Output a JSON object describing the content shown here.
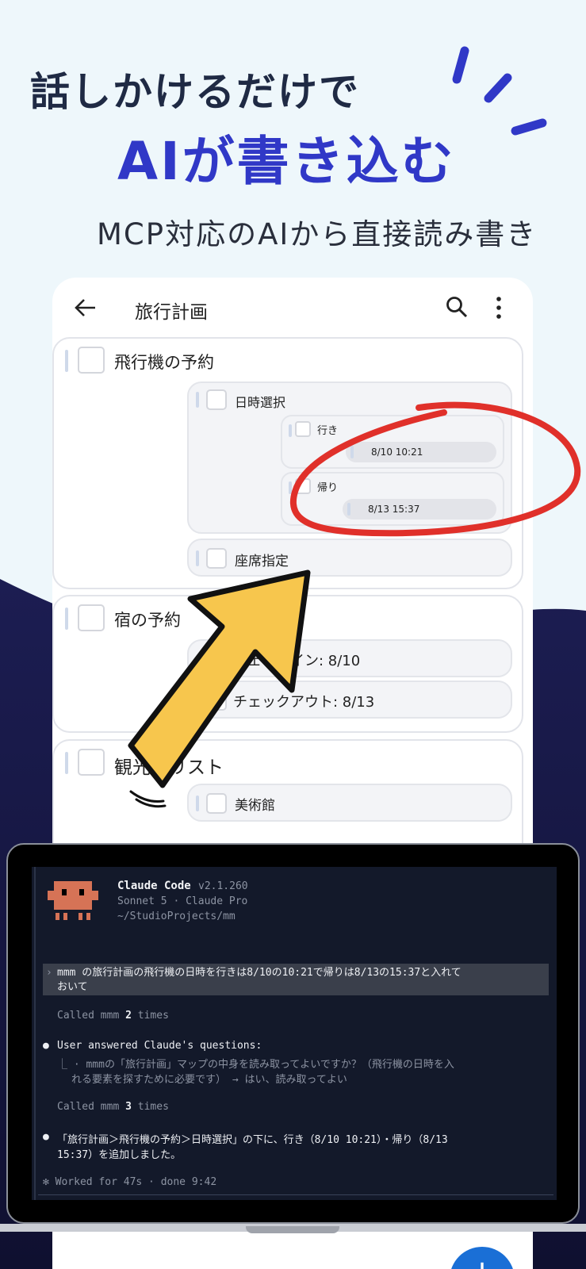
{
  "hero": {
    "line1": "話しかけるだけで",
    "line2": "AIが書き込む",
    "sub": "MCP対応のAIから直接読み書き"
  },
  "colors": {
    "hero_accent": "#3038c7",
    "red_circle": "#e0302a",
    "arrow_fill": "#f7c64d",
    "dark_bg": "#1b1c4e",
    "fab": "#1a6fd6"
  },
  "appbar": {
    "back_icon": "arrow-left-icon",
    "title": "旅行計画",
    "search_icon": "search-icon",
    "more_icon": "more-vert-icon"
  },
  "cards": {
    "flight": {
      "title": "飛行機の予約",
      "datetime": {
        "label": "日時選択",
        "going": {
          "label": "行き",
          "value": "8/10 10:21"
        },
        "return": {
          "label": "帰り",
          "value": "8/13 15:37"
        }
      },
      "seat": {
        "label": "座席指定"
      }
    },
    "hotel": {
      "title": "宿の予約",
      "checkin": "チェックイン: 8/10",
      "checkout": "チェックアウト: 8/13"
    },
    "sightseeing": {
      "title": "観光地リスト",
      "museum": "美術館"
    }
  },
  "terminal": {
    "app": "Claude Code",
    "version": "v2.1.260",
    "model": "Sonnet 5 · Claude Pro",
    "path": "~/StudioProjects/mm",
    "prompt_line1": "mmm の旅行計画の飛行機の日時を行きは8/10の10:21で帰りは8/13の15:37と入れて",
    "prompt_line2": "おいて",
    "called1_pre": "Called mmm",
    "called1_count": "2",
    "called1_post": "times",
    "answered": "User answered Claude's questions:",
    "q_line1": "⎿ · mmmの「旅行計画」マップの中身を読み取ってよいですか？（飛行機の日時を入",
    "q_line2": "れる要素を探すために必要です） → はい、読み取ってよい",
    "called2_pre": "Called mmm",
    "called2_count": "3",
    "called2_post": "times",
    "result_line1": "「旅行計画＞飛行機の予約＞日時選択」の下に、行き（8/10 10:21）・帰り（8/13",
    "result_line2": "15:37）を追加しました。",
    "worked": "✻ Worked for 47s · done 9:42"
  },
  "fab_label": "+"
}
